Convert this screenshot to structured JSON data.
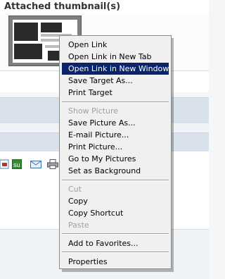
{
  "section_title": "Attached thumbnail(s)",
  "context_menu": {
    "items": [
      {
        "label": "Open Link",
        "state": "normal"
      },
      {
        "label": "Open Link in New Tab",
        "state": "normal"
      },
      {
        "label": "Open Link in New Window",
        "state": "highlighted"
      },
      {
        "label": "Save Target As...",
        "state": "normal"
      },
      {
        "label": "Print Target",
        "state": "normal"
      },
      {
        "label": "Show Picture",
        "state": "disabled"
      },
      {
        "label": "Save Picture As...",
        "state": "normal"
      },
      {
        "label": "E-mail Picture...",
        "state": "normal"
      },
      {
        "label": "Print Picture...",
        "state": "normal"
      },
      {
        "label": "Go to My Pictures",
        "state": "normal"
      },
      {
        "label": "Set as Background",
        "state": "normal"
      },
      {
        "label": "Cut",
        "state": "disabled"
      },
      {
        "label": "Copy",
        "state": "normal"
      },
      {
        "label": "Copy Shortcut",
        "state": "normal"
      },
      {
        "label": "Paste",
        "state": "disabled"
      },
      {
        "label": "Add to Favorites...",
        "state": "normal"
      },
      {
        "label": "Properties",
        "state": "normal"
      }
    ]
  },
  "share_icons": [
    "digg-icon",
    "stumbleupon-icon",
    "email-icon",
    "print-icon"
  ],
  "colors": {
    "menu_highlight": "#0a246a",
    "menu_background": "#f0f0f0",
    "disabled_text": "#a0a0a0",
    "band_blue": "#d9e2ec"
  }
}
